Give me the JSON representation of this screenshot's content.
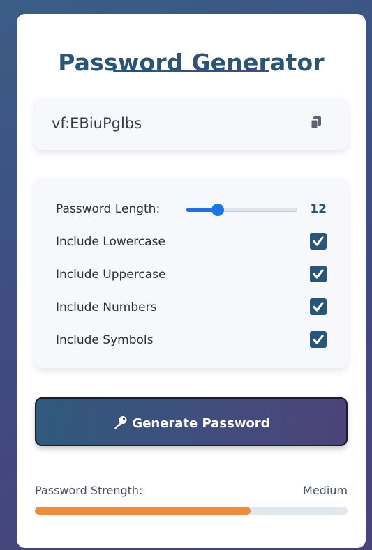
{
  "app": {
    "title": "Password Generator"
  },
  "output": {
    "password": "vf:EBiuPglbs",
    "copy_icon": "copy-icon"
  },
  "settings": {
    "length_label": "Password Length:",
    "length_value": "12",
    "length_min": 4,
    "length_max": 32,
    "options": [
      {
        "label": "Include Lowercase",
        "checked": true
      },
      {
        "label": "Include Uppercase",
        "checked": true
      },
      {
        "label": "Include Numbers",
        "checked": true
      },
      {
        "label": "Include Symbols",
        "checked": true
      }
    ]
  },
  "generate": {
    "label": "Generate Password",
    "icon": "key-icon"
  },
  "strength": {
    "label": "Password Strength:",
    "value": "Medium",
    "level": 0.69,
    "color": "#f08c3a"
  },
  "colors": {
    "primary": "#2c5477",
    "accent_blue": "#1a73e8"
  }
}
